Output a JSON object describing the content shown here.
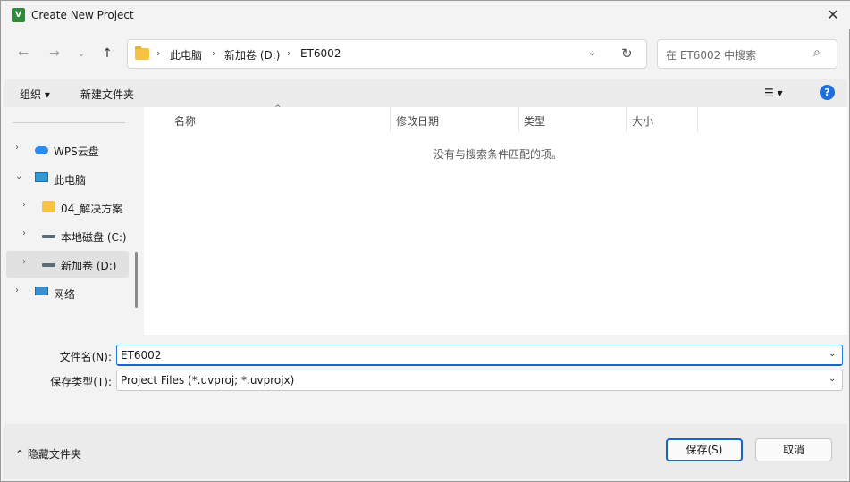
{
  "window": {
    "title": "Create New Project",
    "app_icon_text": "V",
    "close_glyph": "✕"
  },
  "nav": {
    "back": "←",
    "forward": "→",
    "recent": "⌄",
    "up": "↑"
  },
  "address": {
    "crumbs": [
      "此电脑",
      "新加卷 (D:)",
      "ET6002"
    ],
    "separator": "›",
    "dropdown_glyph": "⌄",
    "refresh_glyph": "↻"
  },
  "search": {
    "placeholder": "在 ET6002 中搜索",
    "icon": "⌕"
  },
  "toolbar": {
    "organize": "组织 ▾",
    "new_folder": "新建文件夹",
    "view": "☰ ▾",
    "help": "?"
  },
  "tree": [
    {
      "label": "WPS云盘",
      "chev": "›",
      "icon": "cloud-icon"
    },
    {
      "label": "此电脑",
      "chev": "⌄",
      "icon": "computer-icon"
    },
    {
      "label": "04_解决方案",
      "chev": "›",
      "icon": "folder-icon"
    },
    {
      "label": "本地磁盘 (C:)",
      "chev": "›",
      "icon": "drive-icon"
    },
    {
      "label": "新加卷 (D:)",
      "chev": "›",
      "icon": "drive-icon",
      "selected": true
    },
    {
      "label": "网络",
      "chev": "›",
      "icon": "network-icon"
    }
  ],
  "columns": [
    "名称",
    "修改日期",
    "类型",
    "大小"
  ],
  "sort_glyph": "^",
  "empty_message": "没有与搜索条件匹配的项。",
  "form": {
    "filename_label": "文件名(N):",
    "filename_value": "ET6002",
    "filetype_label": "保存类型(T):",
    "filetype_value": "Project Files (*.uvproj; *.uvprojx)",
    "dropdown_glyph": "⌄"
  },
  "footer": {
    "hide_folders": "⌃  隐藏文件夹",
    "save": "保存(S)",
    "cancel": "取消"
  }
}
